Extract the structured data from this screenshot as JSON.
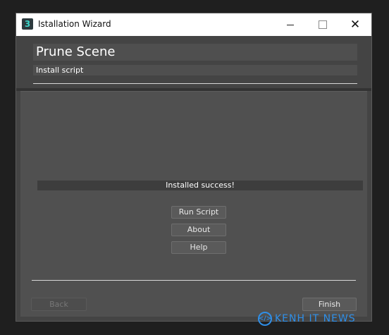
{
  "window": {
    "title": "Istallation Wizard",
    "app_icon_glyph": "3",
    "app_icon": "3ds-max-icon"
  },
  "header": {
    "script_name": "Prune Scene",
    "subtitle": "Install script"
  },
  "content": {
    "status": "Installed success!",
    "buttons": {
      "run": "Run Script",
      "about": "About",
      "help": "Help"
    }
  },
  "footer": {
    "back": "Back",
    "finish": "Finish"
  },
  "watermark": {
    "logo_glyph": "</>",
    "text": "KENH IT NEWS"
  },
  "colors": {
    "window_bg": "#444444",
    "content_bg": "#505050",
    "titlebar_bg": "#ffffff",
    "watermark": "#2f8fe8"
  }
}
